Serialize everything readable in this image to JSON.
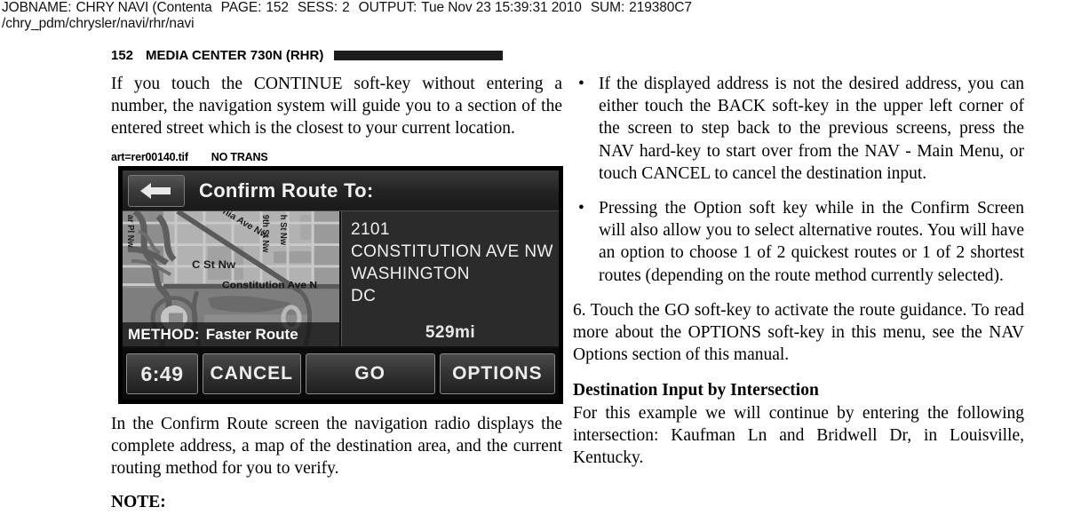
{
  "job_header": {
    "jobname_label": "JOBNAME:",
    "jobname_value": "CHRY NAVI (Contenta",
    "page_label": "PAGE:",
    "page_value": "152",
    "sess_label": "SESS:",
    "sess_value": "2",
    "output_label": "OUTPUT:",
    "output_value": "Tue Nov 23 15:39:31 2010",
    "sum_label": "SUM:",
    "sum_value": "219380C7",
    "path": "/chry_pdm/chrysler/navi/rhr/navi"
  },
  "page_header": {
    "page_number": "152",
    "title": "MEDIA CENTER 730N (RHR)"
  },
  "left_column": {
    "para_1": "If you touch the CONTINUE soft-key without entering a number, the navigation system will guide you to a section of the entered street which is the closest to your current location.",
    "art_caption_file": "art=rer00140.tif",
    "art_caption_trans": "NO TRANS",
    "para_2": "In the Confirm Route screen the navigation radio displays the complete address, a map of the destination area, and the current routing method for you to verify.",
    "note_label": "NOTE:"
  },
  "nav_screen": {
    "back_icon": "back-arrow-icon",
    "title": "Confirm Route To:",
    "address": {
      "number": "2101",
      "street": "CONSTITUTION AVE NW",
      "city": "WASHINGTON",
      "state": "DC"
    },
    "distance": "529mi",
    "method_label": "METHOD:",
    "method_value": "Faster Route",
    "softkeys": {
      "clock": "6:49",
      "cancel": "CANCEL",
      "go": "GO",
      "options": "OPTIONS"
    },
    "map_labels": {
      "diagonal_ave": "nia Ave Nw",
      "c_street": "C St Nw",
      "constitution": "Constitution Ave N",
      "ninth_street": "9th St Nw",
      "left_street": "ar Pl Nw"
    },
    "colors": {
      "screen_bg": "#111111",
      "panel_bg": "#2b2b2b",
      "map_bg": "#8f8f8f",
      "key_text": "#ededed"
    }
  },
  "right_column": {
    "bullets": [
      "If the displayed address is not the desired address, you can either touch the BACK soft-key in the upper left corner of the screen to step back to the previous screens, press the NAV hard-key to start over from the NAV - Main Menu, or touch CANCEL to cancel the destination input.",
      "Pressing the Option soft key while in the Confirm Screen will also allow you to select alternative routes. You will have an option to choose 1 of 2 quickest routes or 1 of 2 shortest routes (depending on the route method currently selected)."
    ],
    "bullet_glyph": "•",
    "step_6": "6. Touch the GO soft-key to activate the route guidance. To read more about the OPTIONS soft-key in this menu, see the NAV Options section of this manual.",
    "subhead": "Destination Input by Intersection",
    "para_after_subhead": "For this example we will continue by entering the following intersection: Kaufman Ln and Bridwell Dr, in Louisville, Kentucky."
  }
}
